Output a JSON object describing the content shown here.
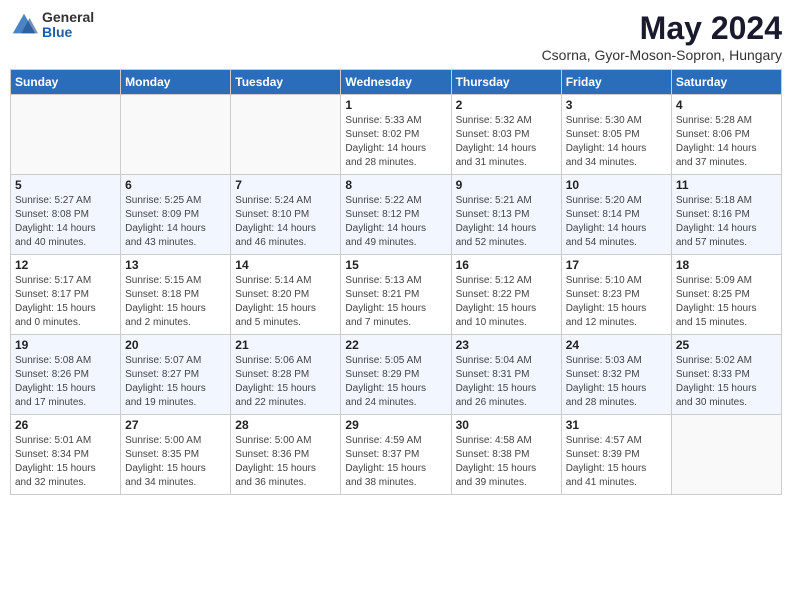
{
  "header": {
    "logo_general": "General",
    "logo_blue": "Blue",
    "month_title": "May 2024",
    "location": "Csorna, Gyor-Moson-Sopron, Hungary"
  },
  "weekdays": [
    "Sunday",
    "Monday",
    "Tuesday",
    "Wednesday",
    "Thursday",
    "Friday",
    "Saturday"
  ],
  "weeks": [
    [
      {
        "day": "",
        "info": ""
      },
      {
        "day": "",
        "info": ""
      },
      {
        "day": "",
        "info": ""
      },
      {
        "day": "1",
        "info": "Sunrise: 5:33 AM\nSunset: 8:02 PM\nDaylight: 14 hours\nand 28 minutes."
      },
      {
        "day": "2",
        "info": "Sunrise: 5:32 AM\nSunset: 8:03 PM\nDaylight: 14 hours\nand 31 minutes."
      },
      {
        "day": "3",
        "info": "Sunrise: 5:30 AM\nSunset: 8:05 PM\nDaylight: 14 hours\nand 34 minutes."
      },
      {
        "day": "4",
        "info": "Sunrise: 5:28 AM\nSunset: 8:06 PM\nDaylight: 14 hours\nand 37 minutes."
      }
    ],
    [
      {
        "day": "5",
        "info": "Sunrise: 5:27 AM\nSunset: 8:08 PM\nDaylight: 14 hours\nand 40 minutes."
      },
      {
        "day": "6",
        "info": "Sunrise: 5:25 AM\nSunset: 8:09 PM\nDaylight: 14 hours\nand 43 minutes."
      },
      {
        "day": "7",
        "info": "Sunrise: 5:24 AM\nSunset: 8:10 PM\nDaylight: 14 hours\nand 46 minutes."
      },
      {
        "day": "8",
        "info": "Sunrise: 5:22 AM\nSunset: 8:12 PM\nDaylight: 14 hours\nand 49 minutes."
      },
      {
        "day": "9",
        "info": "Sunrise: 5:21 AM\nSunset: 8:13 PM\nDaylight: 14 hours\nand 52 minutes."
      },
      {
        "day": "10",
        "info": "Sunrise: 5:20 AM\nSunset: 8:14 PM\nDaylight: 14 hours\nand 54 minutes."
      },
      {
        "day": "11",
        "info": "Sunrise: 5:18 AM\nSunset: 8:16 PM\nDaylight: 14 hours\nand 57 minutes."
      }
    ],
    [
      {
        "day": "12",
        "info": "Sunrise: 5:17 AM\nSunset: 8:17 PM\nDaylight: 15 hours\nand 0 minutes."
      },
      {
        "day": "13",
        "info": "Sunrise: 5:15 AM\nSunset: 8:18 PM\nDaylight: 15 hours\nand 2 minutes."
      },
      {
        "day": "14",
        "info": "Sunrise: 5:14 AM\nSunset: 8:20 PM\nDaylight: 15 hours\nand 5 minutes."
      },
      {
        "day": "15",
        "info": "Sunrise: 5:13 AM\nSunset: 8:21 PM\nDaylight: 15 hours\nand 7 minutes."
      },
      {
        "day": "16",
        "info": "Sunrise: 5:12 AM\nSunset: 8:22 PM\nDaylight: 15 hours\nand 10 minutes."
      },
      {
        "day": "17",
        "info": "Sunrise: 5:10 AM\nSunset: 8:23 PM\nDaylight: 15 hours\nand 12 minutes."
      },
      {
        "day": "18",
        "info": "Sunrise: 5:09 AM\nSunset: 8:25 PM\nDaylight: 15 hours\nand 15 minutes."
      }
    ],
    [
      {
        "day": "19",
        "info": "Sunrise: 5:08 AM\nSunset: 8:26 PM\nDaylight: 15 hours\nand 17 minutes."
      },
      {
        "day": "20",
        "info": "Sunrise: 5:07 AM\nSunset: 8:27 PM\nDaylight: 15 hours\nand 19 minutes."
      },
      {
        "day": "21",
        "info": "Sunrise: 5:06 AM\nSunset: 8:28 PM\nDaylight: 15 hours\nand 22 minutes."
      },
      {
        "day": "22",
        "info": "Sunrise: 5:05 AM\nSunset: 8:29 PM\nDaylight: 15 hours\nand 24 minutes."
      },
      {
        "day": "23",
        "info": "Sunrise: 5:04 AM\nSunset: 8:31 PM\nDaylight: 15 hours\nand 26 minutes."
      },
      {
        "day": "24",
        "info": "Sunrise: 5:03 AM\nSunset: 8:32 PM\nDaylight: 15 hours\nand 28 minutes."
      },
      {
        "day": "25",
        "info": "Sunrise: 5:02 AM\nSunset: 8:33 PM\nDaylight: 15 hours\nand 30 minutes."
      }
    ],
    [
      {
        "day": "26",
        "info": "Sunrise: 5:01 AM\nSunset: 8:34 PM\nDaylight: 15 hours\nand 32 minutes."
      },
      {
        "day": "27",
        "info": "Sunrise: 5:00 AM\nSunset: 8:35 PM\nDaylight: 15 hours\nand 34 minutes."
      },
      {
        "day": "28",
        "info": "Sunrise: 5:00 AM\nSunset: 8:36 PM\nDaylight: 15 hours\nand 36 minutes."
      },
      {
        "day": "29",
        "info": "Sunrise: 4:59 AM\nSunset: 8:37 PM\nDaylight: 15 hours\nand 38 minutes."
      },
      {
        "day": "30",
        "info": "Sunrise: 4:58 AM\nSunset: 8:38 PM\nDaylight: 15 hours\nand 39 minutes."
      },
      {
        "day": "31",
        "info": "Sunrise: 4:57 AM\nSunset: 8:39 PM\nDaylight: 15 hours\nand 41 minutes."
      },
      {
        "day": "",
        "info": ""
      }
    ]
  ]
}
